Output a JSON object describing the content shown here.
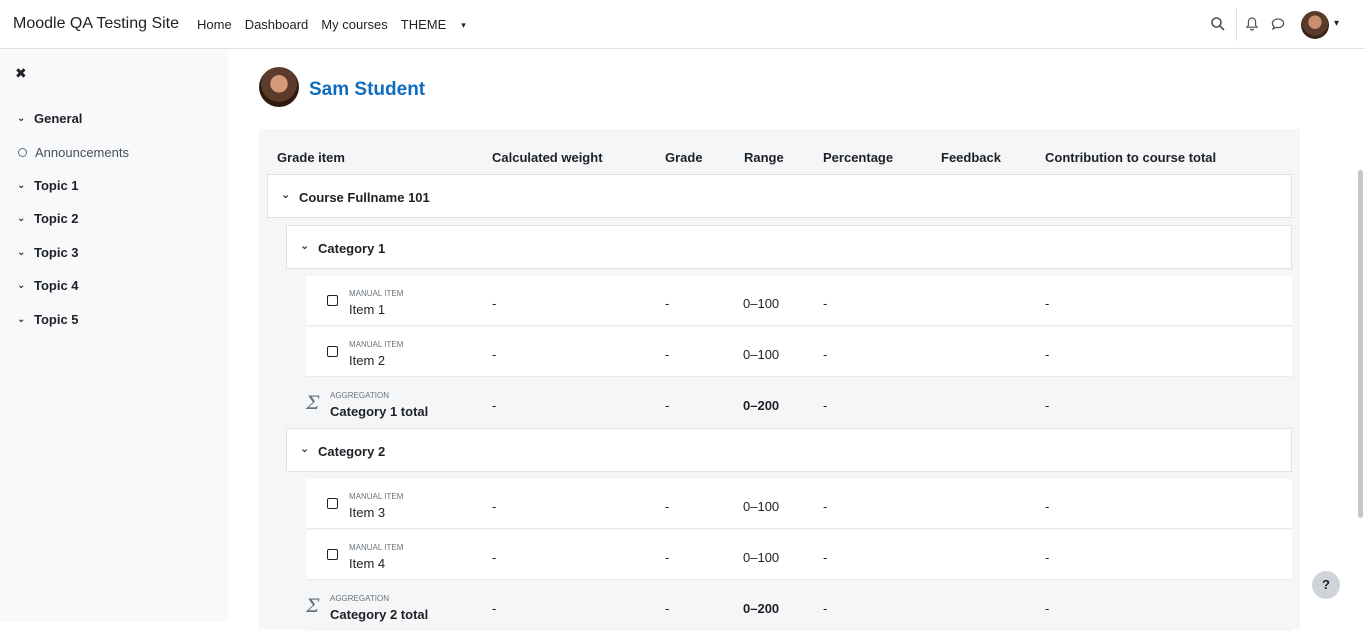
{
  "navbar": {
    "site_name": "Moodle QA Testing Site",
    "links": [
      "Home",
      "Dashboard",
      "My courses",
      "THEME"
    ]
  },
  "drawer": {
    "close_glyph": "✖",
    "items": [
      {
        "label": "General",
        "type": "section"
      },
      {
        "label": "Announcements",
        "type": "activity"
      },
      {
        "label": "Topic 1",
        "type": "section"
      },
      {
        "label": "Topic 2",
        "type": "section"
      },
      {
        "label": "Topic 3",
        "type": "section"
      },
      {
        "label": "Topic 4",
        "type": "section"
      },
      {
        "label": "Topic 5",
        "type": "section"
      }
    ]
  },
  "user": {
    "name": "Sam Student"
  },
  "table": {
    "headers": [
      "Grade item",
      "Calculated weight",
      "Grade",
      "Range",
      "Percentage",
      "Feedback",
      "Contribution to course total"
    ],
    "course": "Course Fullname 101",
    "categories": [
      {
        "name": "Category 1",
        "items": [
          {
            "type": "MANUAL ITEM",
            "name": "Item 1",
            "weight": "-",
            "grade": "-",
            "range": "0–100",
            "percentage": "-",
            "contribution": "-"
          },
          {
            "type": "MANUAL ITEM",
            "name": "Item 2",
            "weight": "-",
            "grade": "-",
            "range": "0–100",
            "percentage": "-",
            "contribution": "-"
          }
        ],
        "total": {
          "type": "AGGREGATION",
          "name": "Category 1 total",
          "weight": "-",
          "grade": "-",
          "range": "0–200",
          "percentage": "-",
          "contribution": "-"
        }
      },
      {
        "name": "Category 2",
        "items": [
          {
            "type": "MANUAL ITEM",
            "name": "Item 3",
            "weight": "-",
            "grade": "-",
            "range": "0–100",
            "percentage": "-",
            "contribution": "-"
          },
          {
            "type": "MANUAL ITEM",
            "name": "Item 4",
            "weight": "-",
            "grade": "-",
            "range": "0–100",
            "percentage": "-",
            "contribution": "-"
          }
        ],
        "total": {
          "type": "AGGREGATION",
          "name": "Category 2 total",
          "weight": "-",
          "grade": "-",
          "range": "0–200",
          "percentage": "-",
          "contribution": "-"
        }
      }
    ]
  },
  "help_button": "?",
  "icons": [
    "search-icon",
    "bell-icon",
    "chat-icon",
    "chevron-down-icon",
    "close-icon",
    "sigma-icon"
  ],
  "colors": {
    "accent": "#0f6cbf",
    "panel": "#f5f6f7",
    "drawer": "#f8f9fa"
  }
}
